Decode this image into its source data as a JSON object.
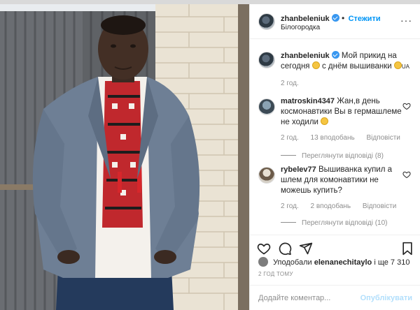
{
  "post": {
    "username": "zhanbeleniuk",
    "follow_label": "Стежити",
    "location": "Білогородка",
    "more_icon": "more-dots-icon"
  },
  "caption": {
    "username": "zhanbeleniuk",
    "text_part1": "Мой прикид на сегодня",
    "text_part2": "с днём вышиванки",
    "flag_text": "UA",
    "time": "2 год."
  },
  "comments": [
    {
      "username": "matroskin4347",
      "text": "Жан,в день космонавтики Вы в гермашлеме не ходили",
      "time": "2 год.",
      "likes": "13 вподобань",
      "reply": "Відповісти",
      "view_replies": "Переглянути відповіді (8)"
    },
    {
      "username": "rybelev77",
      "text": "Вышиванка купил а шлем для комонавтики не можешь купить?",
      "time": "2 год.",
      "likes": "2 вподобань",
      "reply": "Відповісти",
      "view_replies": "Переглянути відповіді (10)"
    }
  ],
  "likes": {
    "prefix": "Уподобали",
    "user": "elenanechitaylo",
    "suffix": "і ще 7 310"
  },
  "post_time": "2 ГОД ТОМУ",
  "add_comment": {
    "placeholder": "Додайте коментар...",
    "publish_label": "Опублікувати"
  },
  "colors": {
    "accent": "#0095f6",
    "publish_disabled": "#b2dffc",
    "muted": "#8e8e8e"
  }
}
